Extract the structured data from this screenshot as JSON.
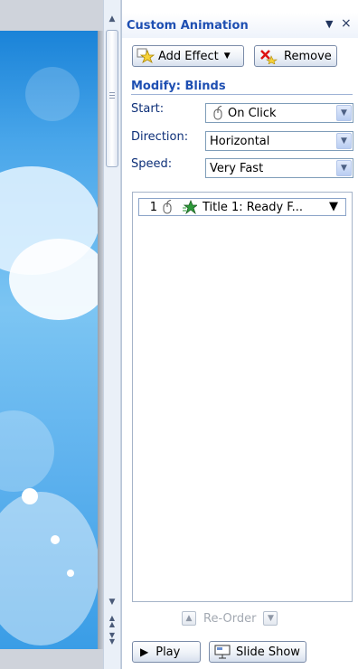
{
  "pane": {
    "title": "Custom Animation",
    "dropdown_glyph": "▼",
    "close_glyph": "×"
  },
  "toolbar": {
    "add_effect_label": "Add Effect",
    "add_effect_arrow": "▼",
    "remove_label": "Remove"
  },
  "modify": {
    "heading": "Modify: Blinds",
    "start_label": "Start:",
    "start_value": "On Click",
    "direction_label": "Direction:",
    "direction_value": "Horizontal",
    "speed_label": "Speed:",
    "speed_value": "Very Fast"
  },
  "animation_list": {
    "items": [
      {
        "number": "1",
        "name": "Title 1: Ready F..."
      }
    ]
  },
  "reorder": {
    "label": "Re-Order"
  },
  "footer": {
    "play_label": "Play",
    "slideshow_label": "Slide Show"
  },
  "colors": {
    "accent": "#1e4fb2",
    "slide_blue": "#49a6ea"
  }
}
